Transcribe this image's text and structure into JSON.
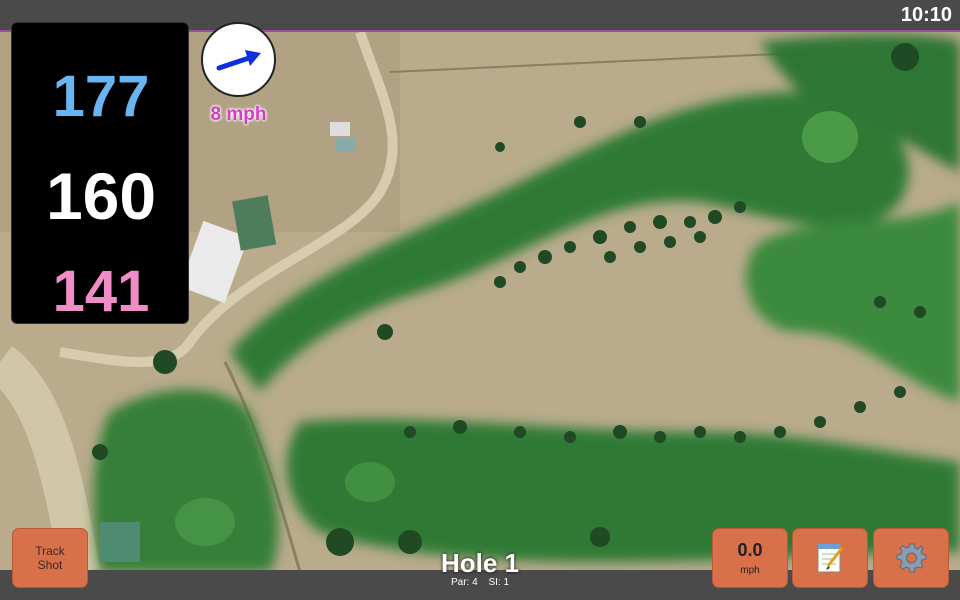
{
  "status": {
    "time": "10:10"
  },
  "distances": {
    "back": "177",
    "center": "160",
    "front": "141"
  },
  "wind": {
    "speed_label": "8 mph",
    "direction_icon": "arrow-icon"
  },
  "hole": {
    "title": "Hole 1",
    "par": "Par: 4",
    "si": "SI: 1"
  },
  "buttons": {
    "track_shot_line1": "Track",
    "track_shot_line2": "Shot",
    "wind_value": "0.0",
    "wind_unit": "mph",
    "notes_icon": "notepad-icon",
    "settings_icon": "gear-icon"
  },
  "colors": {
    "back": "#6ab4f0",
    "center": "#ffffff",
    "front": "#f08cc8",
    "wind_text": "#d43cc8",
    "button": "#d8704a"
  }
}
